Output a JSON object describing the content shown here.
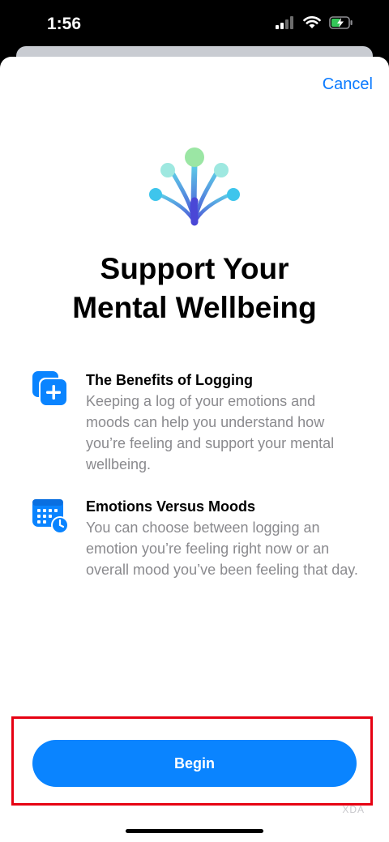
{
  "status_bar": {
    "time": "1:56",
    "icons": [
      "cellular-signal-icon",
      "wifi-icon",
      "battery-charging-icon"
    ],
    "battery_color": "#34c759"
  },
  "header": {
    "cancel_label": "Cancel"
  },
  "hero": {
    "icon": "wellbeing-tree-icon",
    "title_line1": "Support Your",
    "title_line2": "Mental Wellbeing"
  },
  "features": [
    {
      "icon": "add-log-icon",
      "title": "The Benefits of Logging",
      "description": "Keeping a log of your emotions and moods can help you understand how you’re feeling and support your mental wellbeing."
    },
    {
      "icon": "calendar-clock-icon",
      "title": "Emotions Versus Moods",
      "description": "You can choose between logging an emotion you’re feeling right now or an overall mood you’ve been feeling that day."
    }
  ],
  "footer": {
    "begin_label": "Begin",
    "watermark": "XDA"
  },
  "colors": {
    "accent": "#0a84ff",
    "link": "#0a7aff",
    "highlight_frame": "#e60012"
  }
}
